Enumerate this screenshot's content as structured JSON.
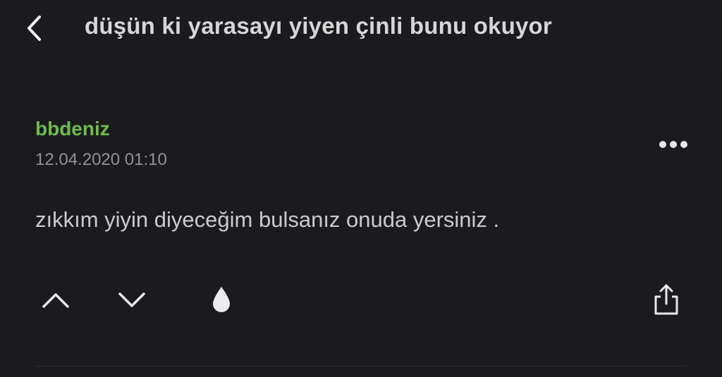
{
  "header": {
    "title": "düşün ki yarasayı yiyen çinli bunu okuyor",
    "back_icon": "chevron-left-icon"
  },
  "entry": {
    "author": "bbdeniz",
    "date": "12.04.2020 01:10",
    "content": "zıkkım yiyin diyeceğim bulsanız onuda yersiniz .",
    "more_icon": "more-horizontal-icon"
  },
  "actions": {
    "upvote_icon": "chevron-up-icon",
    "downvote_icon": "chevron-down-icon",
    "favorite_icon": "drop-icon",
    "share_icon": "share-icon"
  },
  "colors": {
    "background": "#1b1b1d",
    "author": "#6fbb4f",
    "text": "#c9cbce",
    "muted": "#8f939a",
    "icon": "#e8e8ea"
  }
}
